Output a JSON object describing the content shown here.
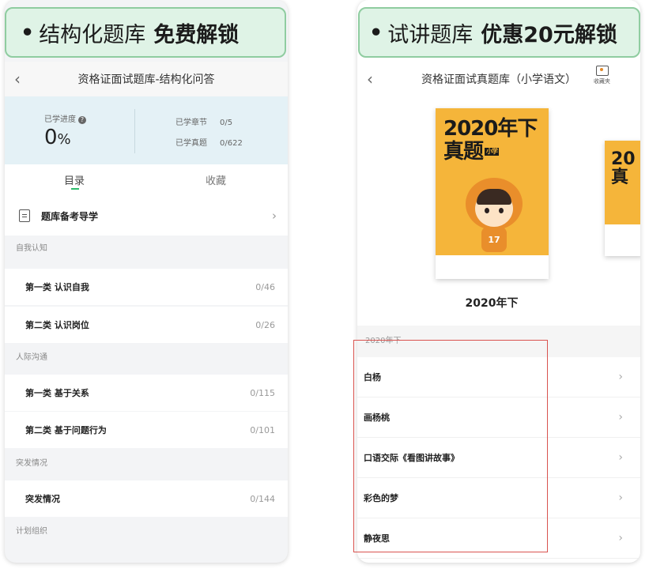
{
  "left_banner": {
    "bullet": "•",
    "text": "结构化题库",
    "emphasis": "免费解锁"
  },
  "right_banner": {
    "bullet": "•",
    "text": "试讲题库",
    "emphasis": "优惠20元解锁"
  },
  "left": {
    "nav": {
      "back": "‹",
      "title": "资格证面试题库-结构化问答"
    },
    "stats": {
      "progress_label": "已学进度",
      "help": "?",
      "progress_value": "0",
      "progress_unit": "%",
      "chapters_label": "已学章节",
      "chapters_value": "0/5",
      "questions_label": "已学真题",
      "questions_value": "0/622"
    },
    "tabs": {
      "catalog": "目录",
      "favorites": "收藏"
    },
    "guide": {
      "label": "题库备考导学",
      "chevron": "›"
    },
    "sections": [
      {
        "header": "自我认知",
        "items": [
          {
            "title": "第一类 认识自我",
            "count": "0/46"
          },
          {
            "title": "第二类 认识岗位",
            "count": "0/26"
          }
        ]
      },
      {
        "header": "人际沟通",
        "items": [
          {
            "title": "第一类 基于关系",
            "count": "0/115"
          },
          {
            "title": "第二类 基于问题行为",
            "count": "0/101"
          }
        ]
      },
      {
        "header": "突发情况",
        "items": [
          {
            "title": "突发情况",
            "count": "0/144"
          }
        ]
      },
      {
        "header": "计划组织",
        "items": []
      }
    ]
  },
  "right": {
    "nav": {
      "back": "‹",
      "title": "资格证面试真题库（小学语文）",
      "favorites_label": "收藏夹"
    },
    "cover": {
      "line1": "2020年下",
      "line2": "真题",
      "tag": "小学",
      "badge": "17",
      "caption": "2020年下"
    },
    "cover2": {
      "line1": "20",
      "line2": "真"
    },
    "section_header": "2020年下",
    "items": [
      {
        "title": "白杨",
        "chevron": "›"
      },
      {
        "title": "画杨桃",
        "chevron": "›"
      },
      {
        "title": "口语交际《看图讲故事》",
        "chevron": "›"
      },
      {
        "title": "彩色的梦",
        "chevron": "›"
      },
      {
        "title": "静夜思",
        "chevron": "›"
      }
    ]
  },
  "colors": {
    "banner_bg": "#dff3e6",
    "banner_border": "#8fcca0",
    "accent_green": "#2dbb6b",
    "cover_yellow": "#f5b53a",
    "highlight_red": "#d9534f"
  }
}
